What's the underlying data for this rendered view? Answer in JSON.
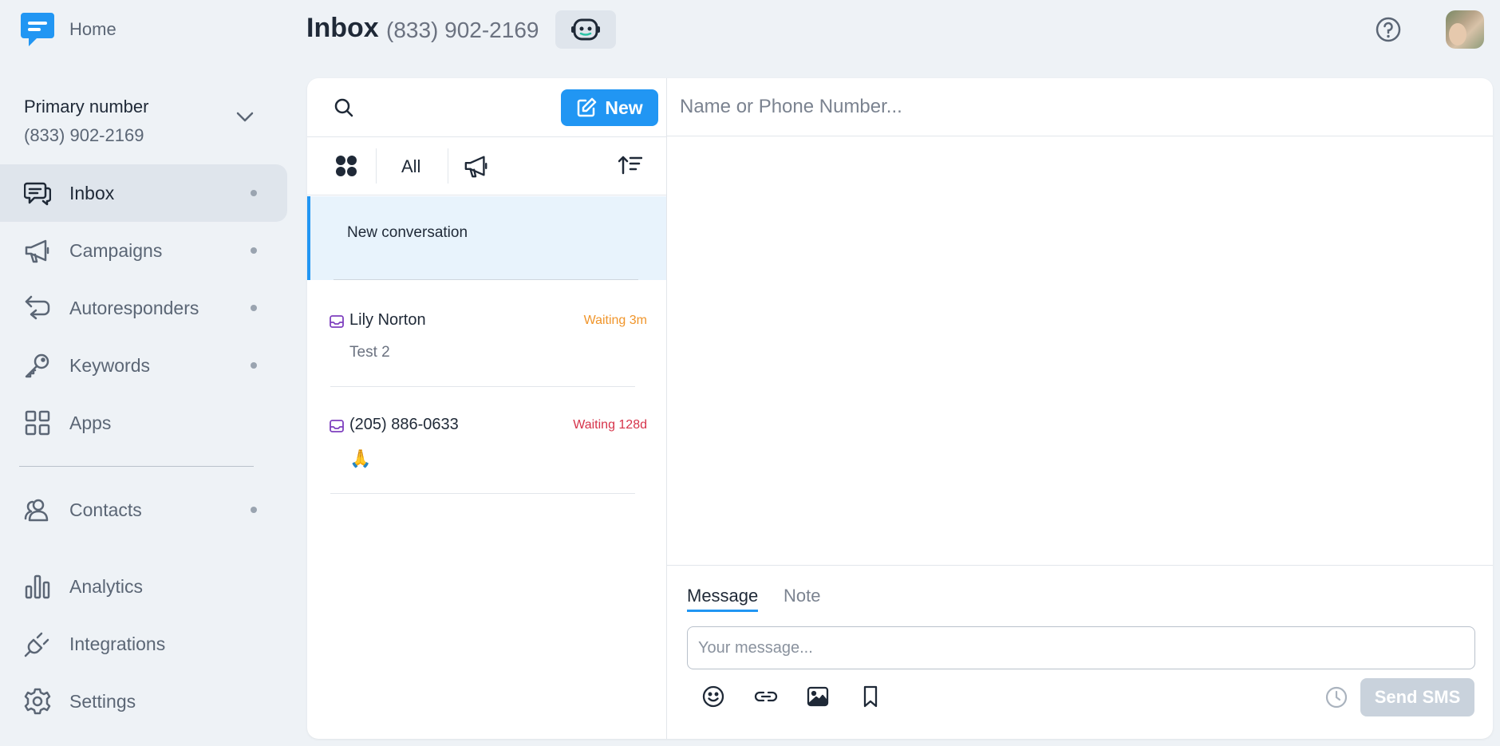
{
  "app": {
    "home_label": "Home"
  },
  "header": {
    "title": "Inbox",
    "phone": "(833) 902-2169"
  },
  "sidebar": {
    "primary_number_label": "Primary number",
    "primary_number_value": "(833) 902-2169",
    "items": [
      {
        "label": "Inbox",
        "icon": "chat-bubbles-icon",
        "active": true,
        "dot": true
      },
      {
        "label": "Campaigns",
        "icon": "megaphone-icon",
        "active": false,
        "dot": true
      },
      {
        "label": "Autoresponders",
        "icon": "reply-arrows-icon",
        "active": false,
        "dot": true
      },
      {
        "label": "Keywords",
        "icon": "key-icon",
        "active": false,
        "dot": true
      },
      {
        "label": "Apps",
        "icon": "apps-grid-icon",
        "active": false,
        "dot": false
      },
      {
        "label": "Contacts",
        "icon": "contacts-icon",
        "active": false,
        "dot": true
      },
      {
        "label": "Analytics",
        "icon": "bar-chart-icon",
        "active": false,
        "dot": false
      },
      {
        "label": "Integrations",
        "icon": "plug-icon",
        "active": false,
        "dot": false
      },
      {
        "label": "Settings",
        "icon": "gear-icon",
        "active": false,
        "dot": false
      }
    ]
  },
  "list": {
    "new_button": "New",
    "filter_all": "All",
    "new_conversation": "New conversation",
    "conversations": [
      {
        "name": "Lily Norton",
        "status": "Waiting 3m",
        "status_color": "#f0952b",
        "preview": "Test 2"
      },
      {
        "name": "(205) 886-0633",
        "status": "Waiting 128d",
        "status_color": "#d6334a",
        "preview": "🙏"
      }
    ]
  },
  "compose": {
    "to_placeholder": "Name or Phone Number...",
    "tab_message": "Message",
    "tab_note": "Note",
    "message_placeholder": "Your message...",
    "send_label": "Send SMS"
  },
  "colors": {
    "accent": "#2196f3",
    "background": "#eef2f6",
    "inbox_icon": "#7e3fbf"
  }
}
